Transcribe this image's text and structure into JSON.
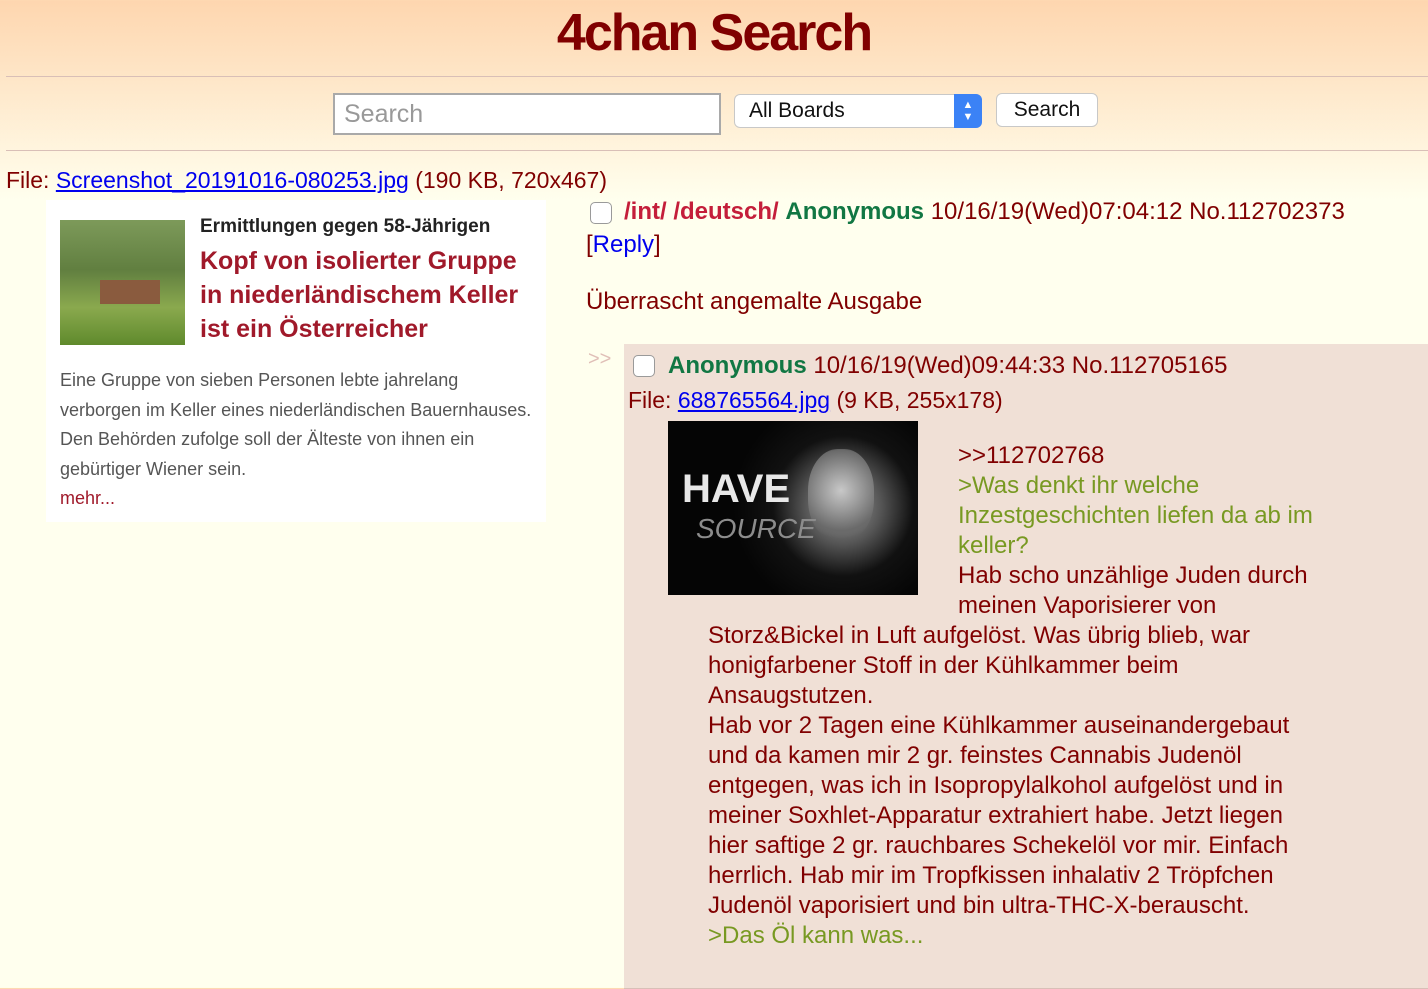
{
  "header": {
    "title": "4chan Search"
  },
  "search": {
    "placeholder": "Search",
    "value": "",
    "board_selected": "All Boards",
    "button_label": "Search"
  },
  "op": {
    "file_label": "File: ",
    "filename": "Screenshot_20191016-080253.jpg",
    "filemeta": " (190 KB, 720x467)",
    "thumb": {
      "kicker": "Ermittlungen gegen 58-Jährigen",
      "headline": "Kopf von isolierter Gruppe in niederländischem Keller ist ein Österreicher",
      "teaser": "Eine Gruppe von sieben Personen lebte jahrelang verborgen im Keller eines niederländischen Bauernhauses. Den Behörden zufolge soll der Älteste von ihnen ein gebürtiger Wiener sein.",
      "more": "mehr..."
    },
    "board1": "/int/",
    "board2": "/deutsch/",
    "name": "Anonymous",
    "datetime": "10/16/19(Wed)07:04:12",
    "number": "No.112702373",
    "reply_link": "Reply",
    "body": "Überrascht angemalte Ausgabe"
  },
  "reply": {
    "arrows": ">>",
    "name": "Anonymous",
    "datetime": "10/16/19(Wed)09:44:33",
    "number": "No.112705165",
    "file_label": "File: ",
    "filename": "688765564.jpg",
    "filemeta": " (9 KB, 255x178)",
    "thumb": {
      "line1": "HAVE",
      "line2": "SOURCE"
    },
    "lines": [
      {
        "text": ">>112702768",
        "quote": false
      },
      {
        "text": ">Was denkt ihr welche",
        "quote": true
      },
      {
        "text": "Inzestgeschichten liefen da ab im",
        "quote": true
      },
      {
        "text": "keller?",
        "quote": true
      },
      {
        "text": "Hab scho unzählige Juden durch",
        "quote": false
      },
      {
        "text": "meinen Vaporisierer von",
        "quote": false
      },
      {
        "text": "Storz&Bickel in Luft aufgelöst. Was übrig blieb, war",
        "quote": false
      },
      {
        "text": "honigfarbener Stoff in der Kühlkammer beim",
        "quote": false
      },
      {
        "text": "Ansaugstutzen.",
        "quote": false
      },
      {
        "text": "Hab vor 2 Tagen eine Kühlkammer auseinandergebaut",
        "quote": false
      },
      {
        "text": "und da kamen mir 2 gr. feinstes Cannabis Judenöl",
        "quote": false
      },
      {
        "text": "entgegen, was ich in Isopropylalkohol aufgelöst und in",
        "quote": false
      },
      {
        "text": "meiner Soxhlet-Apparatur extrahiert habe. Jetzt liegen",
        "quote": false
      },
      {
        "text": "hier saftige 2 gr. rauchbares Schekelöl vor mir. Einfach",
        "quote": false
      },
      {
        "text": "herrlich. Hab mir im Tropfkissen inhalativ 2 Tröpfchen",
        "quote": false
      },
      {
        "text": "Judenöl vaporisiert und bin ultra-THC-X-berauscht.",
        "quote": false
      },
      {
        "text": ">Das Öl kann was...",
        "quote": true
      }
    ]
  },
  "colors": {
    "text": "#800000",
    "name": "#117743",
    "quote": "#789922",
    "link": "#0000ee",
    "reply_bg": "#f0e0d6",
    "board": "#c41e3a"
  }
}
